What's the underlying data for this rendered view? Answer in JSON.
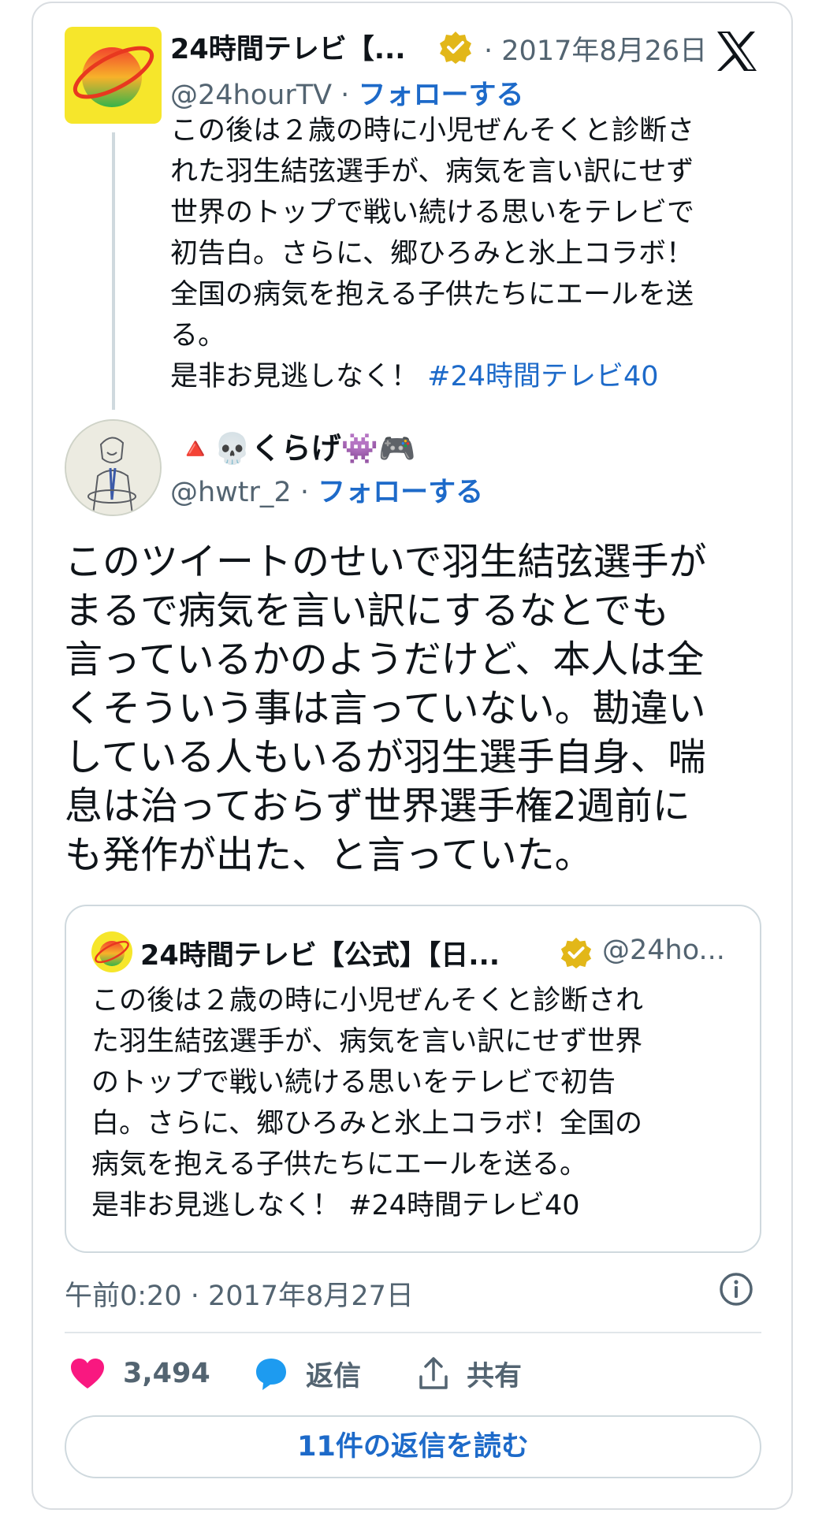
{
  "parent": {
    "name": "24時間テレビ【...",
    "date": "2017年8月26日",
    "handle": "@24hourTV",
    "follow": "フォローする",
    "text": "この後は２歳の時に小児ぜんそくと診断さ\nれた羽生結弦選手が、病気を言い訳にせず\n世界のトップで戦い続ける思いをテレビで\n初告白。さらに、郷ひろみと氷上コラボ！\n全国の病気を抱える子供たちにエールを送\nる。\n是非お見逃しなく！ ",
    "hashtag": "#24時間テレビ40"
  },
  "main": {
    "name": "🔺💀くらげ👾🎮",
    "handle": "@hwtr_2",
    "follow": "フォローする",
    "text": "このツイートのせいで羽生結弦選手が\nまるで病気を言い訳にするなとでも\n言っているかのようだけど、本人は全\nくそういう事は言っていない。勘違い\nしている人もいるが羽生選手自身、喘\n息は治っておらず世界選手権2週前に\nも発作が出た、と言っていた。"
  },
  "quote": {
    "name": "24時間テレビ【公式】【日...",
    "handle": "@24ho...",
    "text": "この後は２歳の時に小児ぜんそくと診断され\nた羽生結弦選手が、病気を言い訳にせず世界\nのトップで戦い続ける思いをテレビで初告\n白。さらに、郷ひろみと氷上コラボ！全国の\n病気を抱える子供たちにエールを送る。\n是非お見逃しなく！ #24時間テレビ40"
  },
  "meta": {
    "time": "午前0:20 · 2017年8月27日",
    "separator": "·"
  },
  "actions": {
    "likes": "3,494",
    "reply": "返信",
    "share": "共有"
  },
  "read_replies": "11件の返信を読む",
  "colors": {
    "link": "#1d6ac9",
    "like": "#f91880",
    "reply": "#1d9bf0",
    "muted": "#536471",
    "verified": "#e2b719"
  },
  "icons": [
    "verified-badge-icon",
    "x-logo-icon",
    "heart-icon",
    "reply-bubble-icon",
    "share-icon",
    "info-icon"
  ]
}
